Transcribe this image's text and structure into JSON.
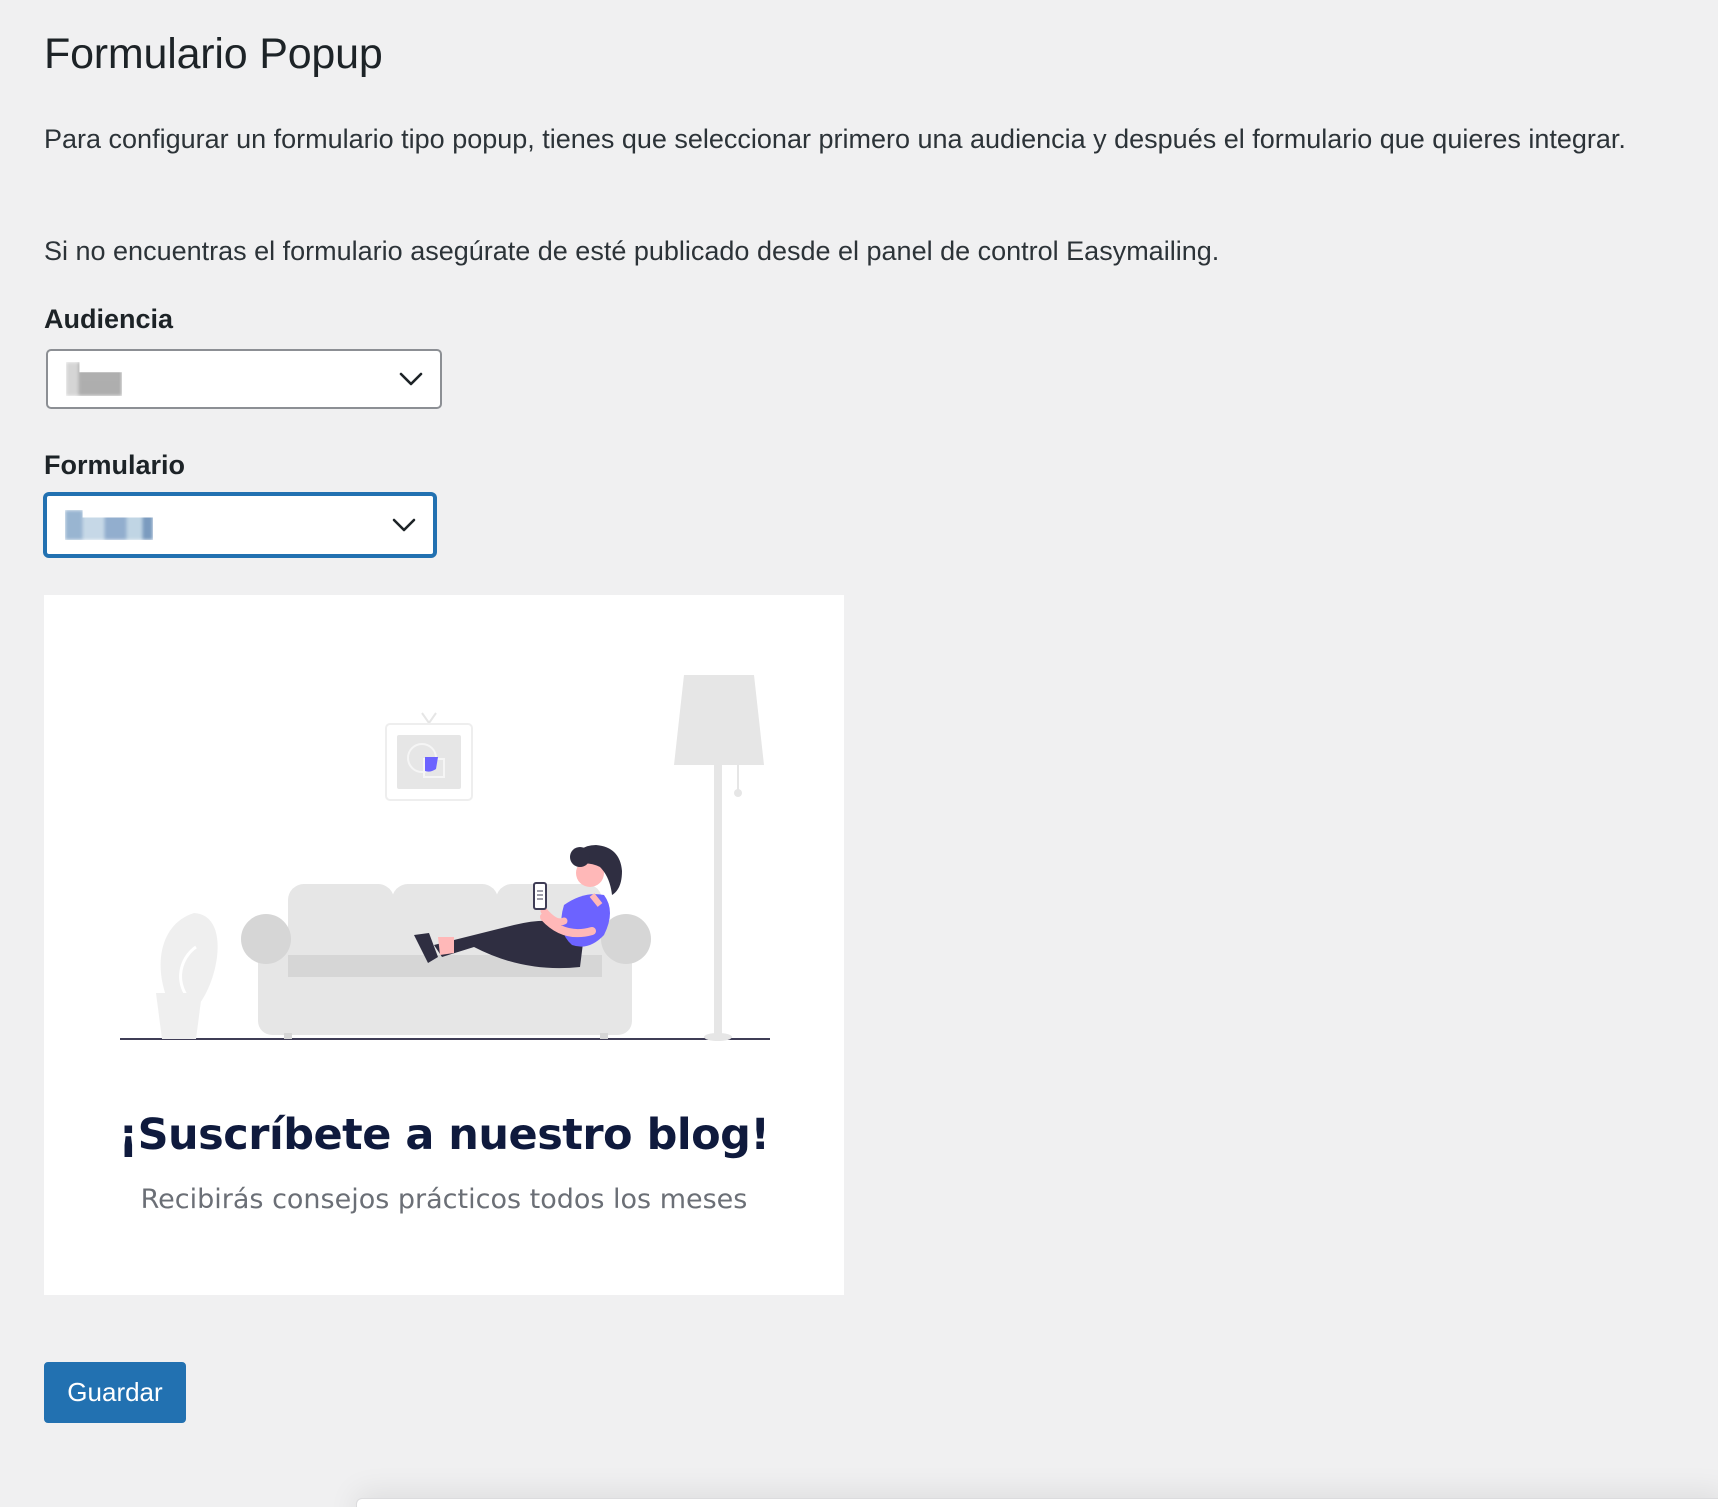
{
  "page": {
    "title": "Formulario Popup",
    "description_1": "Para configurar un formulario tipo popup, tienes que seleccionar primero una audiencia y después el formulario que quieres integrar.",
    "description_2": "Si no encuentras el formulario asegúrate de esté publicado desde el panel de control Easymailing."
  },
  "fields": {
    "audience": {
      "label": "Audiencia",
      "icon": "chevron-down-icon"
    },
    "form": {
      "label": "Formulario",
      "icon": "chevron-down-icon"
    }
  },
  "preview": {
    "heading": "¡Suscríbete a nuestro blog!",
    "subheading": "Recibirás consejos prácticos todos los meses"
  },
  "actions": {
    "save_label": "Guardar"
  },
  "colors": {
    "accent": "#2271b1",
    "background": "#f0f0f1",
    "illustration_accent": "#6c63ff"
  }
}
